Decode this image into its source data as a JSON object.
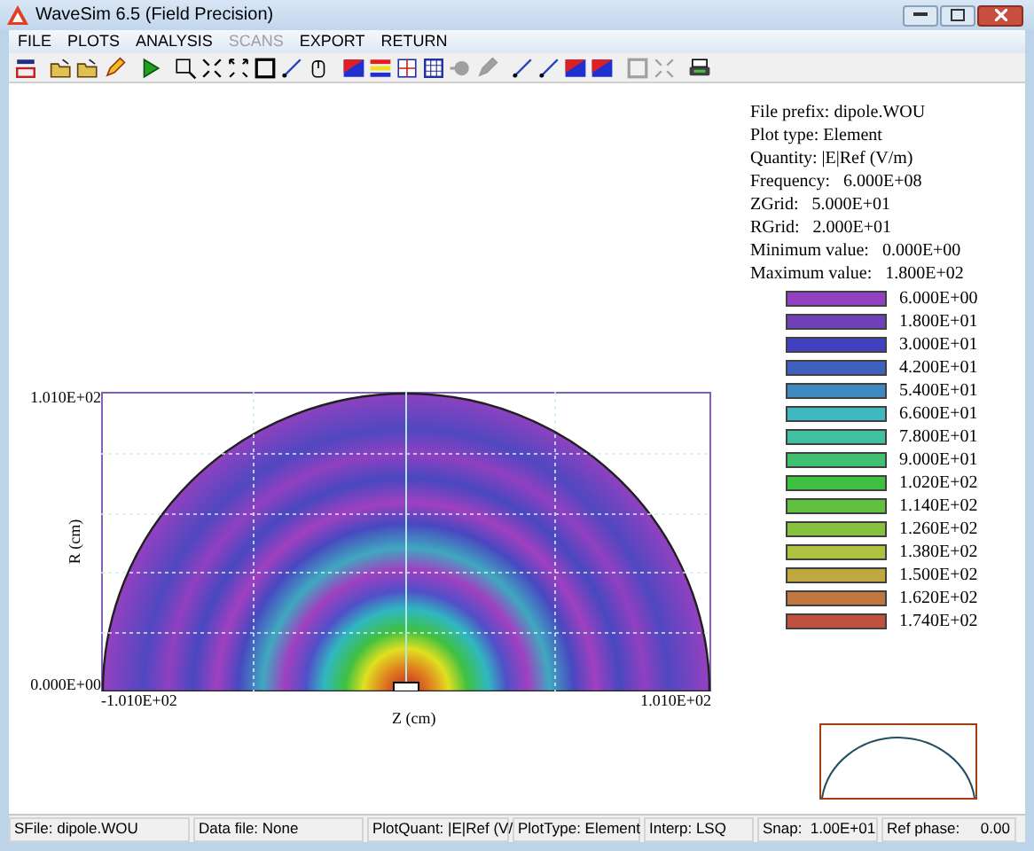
{
  "window": {
    "title": "WaveSim 6.5 (Field Precision)"
  },
  "menu": [
    {
      "label": "FILE",
      "disabled": false
    },
    {
      "label": "PLOTS",
      "disabled": false
    },
    {
      "label": "ANALYSIS",
      "disabled": false
    },
    {
      "label": "SCANS",
      "disabled": true
    },
    {
      "label": "EXPORT",
      "disabled": false
    },
    {
      "label": "RETURN",
      "disabled": false
    }
  ],
  "toolbar": [
    [
      {
        "kind": "exit",
        "disabled": false
      }
    ],
    [
      {
        "kind": "open",
        "disabled": false
      },
      {
        "kind": "open",
        "disabled": false
      },
      {
        "kind": "pencil",
        "disabled": false
      }
    ],
    [
      {
        "kind": "play",
        "disabled": false
      }
    ],
    [
      {
        "kind": "zoom",
        "disabled": false
      },
      {
        "kind": "shrink",
        "disabled": false
      },
      {
        "kind": "expand",
        "disabled": false
      },
      {
        "kind": "frame",
        "disabled": false
      },
      {
        "kind": "line",
        "disabled": false
      },
      {
        "kind": "probe",
        "disabled": false
      }
    ],
    [
      {
        "kind": "colors",
        "disabled": false
      },
      {
        "kind": "bands",
        "disabled": false
      },
      {
        "kind": "grid",
        "disabled": false
      },
      {
        "kind": "table",
        "disabled": false
      },
      {
        "kind": "marker",
        "disabled": true
      },
      {
        "kind": "pencil",
        "disabled": true
      }
    ],
    [
      {
        "kind": "line",
        "disabled": false
      },
      {
        "kind": "line",
        "disabled": false
      },
      {
        "kind": "colors",
        "disabled": false
      },
      {
        "kind": "colors",
        "disabled": false
      }
    ],
    [
      {
        "kind": "frame",
        "disabled": true
      },
      {
        "kind": "shrink",
        "disabled": true
      }
    ],
    [
      {
        "kind": "print",
        "disabled": false
      }
    ]
  ],
  "plot": {
    "y_max": "1.010E+02",
    "y_min": "0.000E+00",
    "x_min": "-1.010E+02",
    "x_max": "1.010E+02",
    "xlabel": "Z (cm)",
    "ylabel": "R (cm)"
  },
  "info": [
    "File prefix: dipole.WOU",
    "Plot type: Element",
    "Quantity: |E|Ref (V/m)",
    "Frequency:   6.000E+08",
    "ZGrid:   5.000E+01",
    "RGrid:   2.000E+01",
    "Minimum value:   0.000E+00",
    "Maximum value:   1.800E+02"
  ],
  "legend": [
    {
      "value": "6.000E+00",
      "color": "#9040c0"
    },
    {
      "value": "1.800E+01",
      "color": "#7040b8"
    },
    {
      "value": "3.000E+01",
      "color": "#4040c0"
    },
    {
      "value": "4.200E+01",
      "color": "#4060c0"
    },
    {
      "value": "5.400E+01",
      "color": "#4088c0"
    },
    {
      "value": "6.600E+01",
      "color": "#40b8c0"
    },
    {
      "value": "7.800E+01",
      "color": "#40c0a0"
    },
    {
      "value": "9.000E+01",
      "color": "#40c070"
    },
    {
      "value": "1.020E+02",
      "color": "#40c040"
    },
    {
      "value": "1.140E+02",
      "color": "#60c040"
    },
    {
      "value": "1.260E+02",
      "color": "#88c040"
    },
    {
      "value": "1.380E+02",
      "color": "#b0c040"
    },
    {
      "value": "1.500E+02",
      "color": "#c0a840"
    },
    {
      "value": "1.620E+02",
      "color": "#c07840"
    },
    {
      "value": "1.740E+02",
      "color": "#c05040"
    }
  ],
  "status_bar": [
    "SFile: dipole.WOU",
    "Data file: None",
    "PlotQuant: |E|Ref (V/",
    "PlotType: Element",
    "Interp: LSQ",
    "Snap:  1.00E+01",
    "Ref phase:     0.00"
  ]
}
